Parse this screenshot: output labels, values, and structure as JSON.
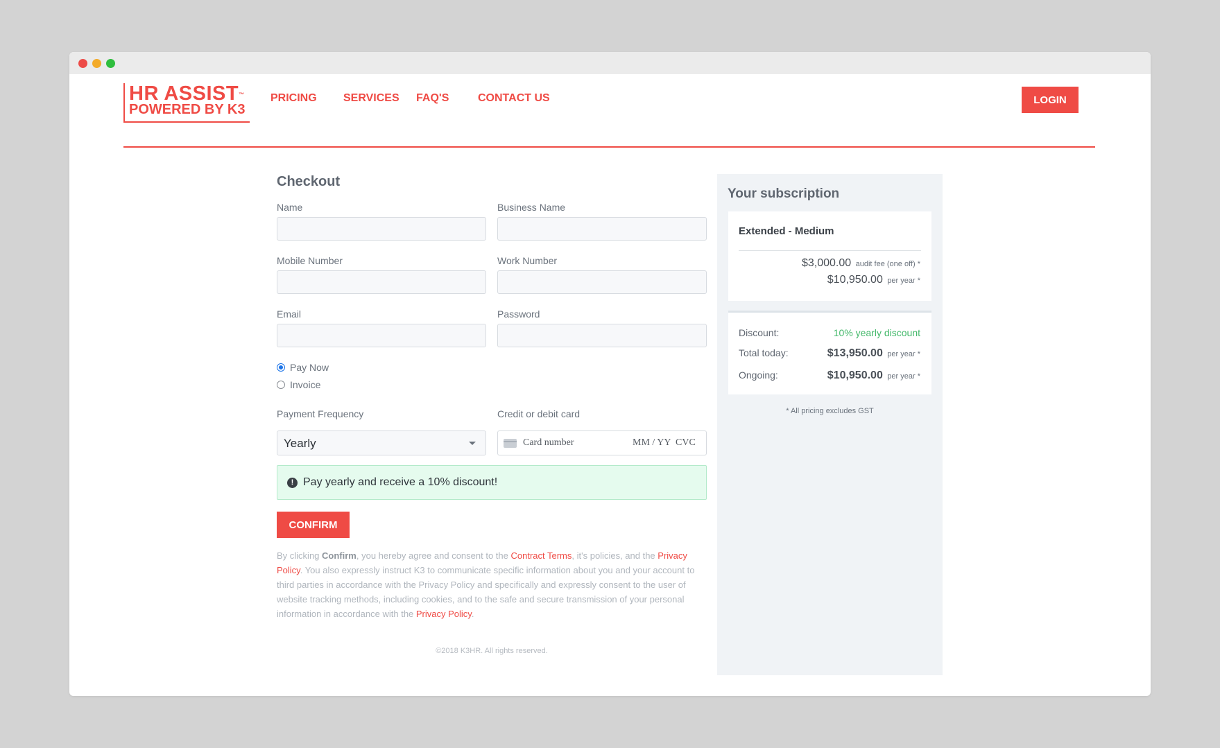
{
  "brand": {
    "logo_line1": "HR ASSIST",
    "logo_tm": "™",
    "logo_line2": "POWERED BY K3"
  },
  "nav": {
    "items": [
      "PRICING",
      "SERVICES",
      "FAQ'S",
      "CONTACT US"
    ],
    "login": "LOGIN"
  },
  "colors": {
    "accent": "#ef4b45",
    "success_bg": "#e5fbee",
    "success_text": "#43b86a",
    "panel_bg": "#f0f3f6"
  },
  "checkout": {
    "title": "Checkout",
    "fields": {
      "name": {
        "label": "Name",
        "value": ""
      },
      "business_name": {
        "label": "Business Name",
        "value": ""
      },
      "mobile": {
        "label": "Mobile Number",
        "value": ""
      },
      "work": {
        "label": "Work Number",
        "value": ""
      },
      "email": {
        "label": "Email",
        "value": ""
      },
      "password": {
        "label": "Password",
        "value": ""
      }
    },
    "payment_options": [
      {
        "label": "Pay Now",
        "selected": true
      },
      {
        "label": "Invoice",
        "selected": false
      }
    ],
    "frequency": {
      "label": "Payment Frequency",
      "value": "Yearly"
    },
    "card": {
      "label": "Credit or debit card",
      "number_placeholder": "Card number",
      "expiry_placeholder": "MM / YY",
      "cvc_placeholder": "CVC"
    },
    "alert": "Pay yearly and receive a 10% discount!",
    "confirm": "CONFIRM",
    "legal": {
      "p1": "By clicking ",
      "confirm_word": "Confirm",
      "p2": ", you hereby agree and consent to the ",
      "contract_link": "Contract Terms",
      "p3": ", it's policies, and the ",
      "privacy_link": "Privacy Policy",
      "p4": ". You also expressly instruct K3 to communicate specific information about you and your account to third parties in accordance with the Privacy Policy and specifically and expressly consent to the user of website tracking methods, including cookies, and to the safe and secure transmission of your personal information in accordance with the ",
      "privacy_link2": "Privacy Policy",
      "p5": "."
    },
    "footer": "©2018 K3HR. All rights reserved."
  },
  "subscription": {
    "title": "Your subscription",
    "plan": "Extended - Medium",
    "audit_fee": {
      "amount": "$3,000.00",
      "note": "audit fee (one off) *"
    },
    "yearly": {
      "amount": "$10,950.00",
      "note": "per year *"
    },
    "discount": {
      "label": "Discount:",
      "value": "10% yearly discount"
    },
    "total_today": {
      "label": "Total today:",
      "amount": "$13,950.00",
      "note": "per year *"
    },
    "ongoing": {
      "label": "Ongoing:",
      "amount": "$10,950.00",
      "note": "per year *"
    },
    "gst_note": "* All pricing excludes GST"
  }
}
